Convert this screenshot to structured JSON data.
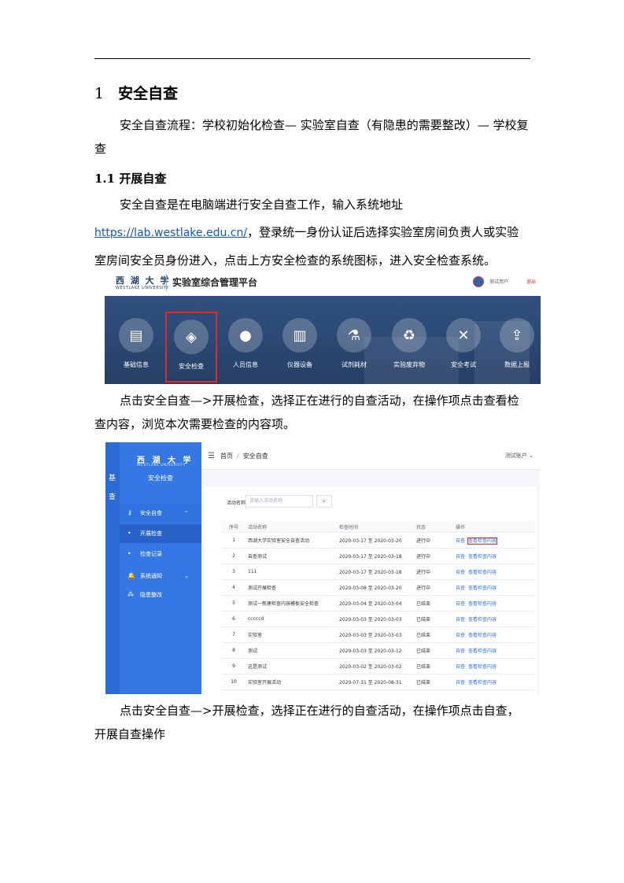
{
  "section_heading": {
    "number": "1",
    "title": "安全自查"
  },
  "intro_paragraph": "安全自查流程：学校初始化检查— 实验室自查（有隐患的需要整改）— 学校复查",
  "subsection_heading": "1.1 开展自查",
  "paragraph_access": {
    "before_link": "安全自查是在电脑端进行安全自查工作，输入系统地址",
    "link": "https://lab.westlake.edu.cn/",
    "after_link": "，登录统一身份认证后选择实验室房间负责人或实验室房间安全员身份进入，点击上方安全检查的系统图标，进入安全检查系统。"
  },
  "screenshot_portal": {
    "logo_text": "西 湖 大 学",
    "logo_subtext": "WESTLAKE UNIVERSITY",
    "platform_title": "实验室综合管理平台",
    "user_label": "测试用户",
    "exit_label": "退出",
    "tiles": [
      {
        "label": "基础信息",
        "icon": "monitor-icon",
        "glyph": "▤",
        "selected": false
      },
      {
        "label": "安全检查",
        "icon": "shield-icon",
        "glyph": "◈",
        "selected": true
      },
      {
        "label": "人员信息",
        "icon": "person-icon",
        "glyph": "●",
        "selected": false
      },
      {
        "label": "仪器设备",
        "icon": "books-icon",
        "glyph": "▥",
        "selected": false
      },
      {
        "label": "试剂耗材",
        "icon": "flask-icon",
        "glyph": "⚗",
        "selected": false
      },
      {
        "label": "实验废弃物",
        "icon": "recycle-icon",
        "glyph": "♻",
        "selected": false
      },
      {
        "label": "安全考试",
        "icon": "pencil-cross-icon",
        "glyph": "✕",
        "selected": false
      },
      {
        "label": "数据上报",
        "icon": "upload-icon",
        "glyph": "⇪",
        "selected": false
      }
    ]
  },
  "paragraph_view": "点击安全自查—>开展检查，选择正在进行的自查活动，在操作项点击查看检查内容，浏览本次需要检查的内容项。",
  "screenshot_selfcheck": {
    "rail_chars": [
      "基",
      "查"
    ],
    "logo_text": "西 湖 大 学",
    "logo_subtext": "WESTLAKE UNIVERSITY",
    "side_title": "安全检查",
    "menu": [
      {
        "label": "安全自查",
        "icon": "key-icon",
        "glyph": "⚷",
        "type": "group",
        "chevron": "⌃"
      },
      {
        "label": "开展检查",
        "icon": "dot-icon",
        "glyph": "•",
        "type": "active",
        "chevron": ""
      },
      {
        "label": "检查记录",
        "icon": "dot-icon",
        "glyph": "•",
        "type": "sub",
        "chevron": ""
      },
      {
        "label": "系统通知",
        "icon": "bell-icon",
        "glyph": "🔔",
        "type": "normal",
        "chevron": "⌄"
      },
      {
        "label": "隐患整改",
        "icon": "sitemap-icon",
        "glyph": "⁂",
        "type": "normal",
        "chevron": ""
      }
    ],
    "breadcrumb": [
      "首页",
      "安全自查"
    ],
    "account": "测试账户 ⌄",
    "search_label": "活动名称",
    "search_placeholder": "请输入活动名称",
    "search_button": "⌕",
    "columns": [
      "序号",
      "活动名称",
      "检查时间",
      "状态",
      "操作"
    ],
    "rows": [
      {
        "no": "1",
        "name": "西湖大学实验室安全自查活动",
        "time": "2020-03-17 至 2020-03-20",
        "state": "进行中",
        "ops": [
          "自查",
          "查看检查内容"
        ],
        "highlight": true
      },
      {
        "no": "2",
        "name": "自查测试",
        "time": "2020-03-17 至 2020-03-18",
        "state": "进行中",
        "ops": [
          "自查",
          "查看检查内容"
        ],
        "highlight": false
      },
      {
        "no": "3",
        "name": "111",
        "time": "2020-03-17 至 2020-03-18",
        "state": "进行中",
        "ops": [
          "自查",
          "查看检查内容"
        ],
        "highlight": false
      },
      {
        "no": "4",
        "name": "测试开展检查",
        "time": "2020-03-08 至 2020-03-20",
        "state": "进行中",
        "ops": [
          "自查",
          "查看检查内容"
        ],
        "highlight": false
      },
      {
        "no": "5",
        "name": "测试一新建检查内容模板安全检查",
        "time": "2020-03-04 至 2020-03-04",
        "state": "已结束",
        "ops": [
          "自查",
          "查看检查内容"
        ],
        "highlight": false
      },
      {
        "no": "6",
        "name": "cccccd",
        "time": "2020-03-03 至 2020-03-03",
        "state": "已结束",
        "ops": [
          "自查",
          "查看检查内容"
        ],
        "highlight": false
      },
      {
        "no": "7",
        "name": "实验室",
        "time": "2020-03-03 至 2020-03-03",
        "state": "已结束",
        "ops": [
          "自查",
          "查看检查内容"
        ],
        "highlight": false
      },
      {
        "no": "8",
        "name": "测试",
        "time": "2020-03-03 至 2020-03-12",
        "state": "已结束",
        "ops": [
          "自查",
          "查看检查内容"
        ],
        "highlight": false
      },
      {
        "no": "9",
        "name": "这是测试",
        "time": "2020-03-02 至 2020-03-02",
        "state": "已结束",
        "ops": [
          "自查",
          "查看检查内容"
        ],
        "highlight": false
      },
      {
        "no": "10",
        "name": "实验室开展活动",
        "time": "2020-07-31 至 2020-08-31",
        "state": "已结束",
        "ops": [
          "自查",
          "查看检查内容"
        ],
        "highlight": false
      }
    ]
  },
  "paragraph_perform": "点击安全自查—>开展检查，选择正在进行的自查活动，在操作项点击自查，开展自查操作",
  "colors": {
    "link": "#1a55c2",
    "sidebar": "#3578e5",
    "highlight_border": "#e02a2a",
    "banner": "#2c4a76"
  }
}
